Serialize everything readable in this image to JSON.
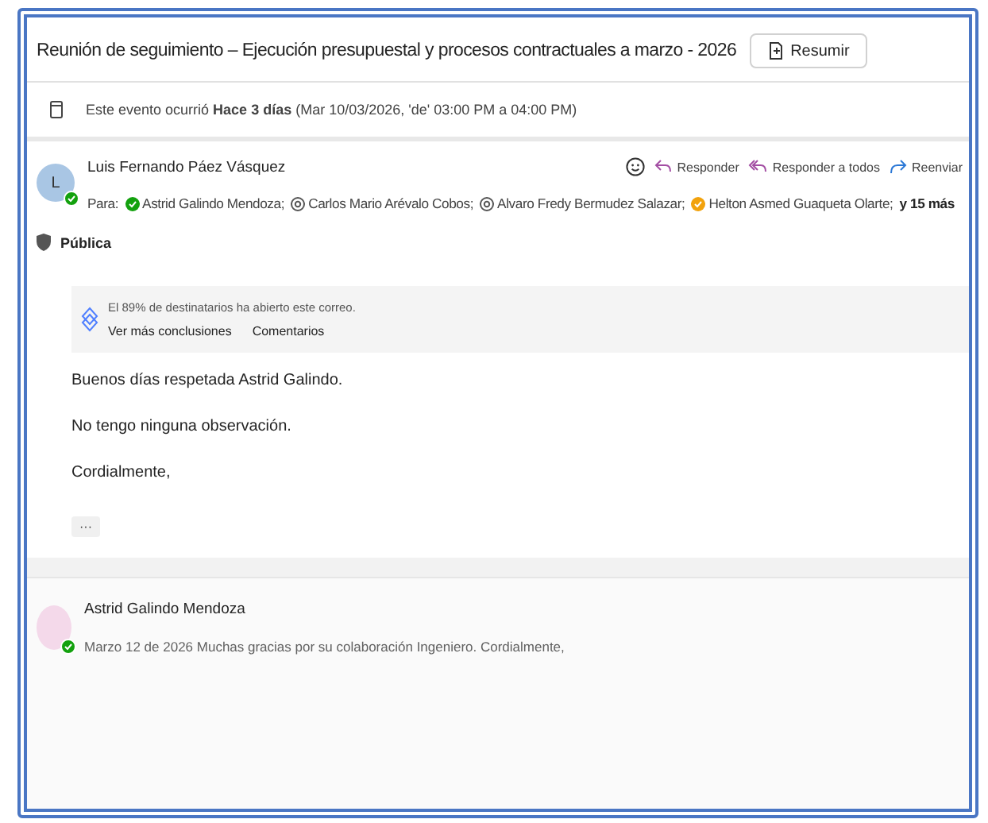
{
  "subject": {
    "title": "Reunión de seguimiento – Ejecución presupuestal y procesos contractuales a marzo - 2026",
    "summarize_button": "Resumir"
  },
  "event_notice": {
    "prefix": "Este evento ocurrió",
    "emphasis": "Hace 3 días",
    "suffix": "(Mar 10/03/2026, 'de' 03:00 PM a 04:00 PM)"
  },
  "message": {
    "sender": "Luis Fernando Páez Vásquez",
    "avatar_initial": "L",
    "sender_online": true,
    "actions": [
      {
        "label": "Responder",
        "kind": "reply"
      },
      {
        "label": "Responder a todos",
        "kind": "reply-all"
      },
      {
        "label": "Reenviar",
        "kind": "forward"
      }
    ],
    "to_label": "Para:",
    "recipients": [
      {
        "name": "Astrid Galindo Mendoza;",
        "kind": "available"
      },
      {
        "name": "Carlos Mario Arévalo Cobos;",
        "kind": "unknown"
      },
      {
        "name": "Alvaro Fredy Bermudez Salazar;",
        "kind": "unknown"
      },
      {
        "name": "Helton Asmed Guaqueta Olarte;",
        "kind": "away"
      }
    ],
    "more_recipients": "y 15 más",
    "sensitivity": "Pública",
    "insight": {
      "text": "El 89% de destinatarios ha abierto este correo.",
      "links": [
        "Ver más conclusiones",
        "Comentarios"
      ]
    },
    "body": [
      "Buenos días respetada Astrid Galindo.",
      "No tengo ninguna observación.",
      "Cordialmente,"
    ],
    "expand_button": "···"
  },
  "collapsed_message": {
    "sender": "Astrid Galindo Mendoza",
    "sender_online": true,
    "preview": "Marzo 12 de 2026 Muchas gracias por su colaboración Ingeniero. Cordialmente,"
  }
}
